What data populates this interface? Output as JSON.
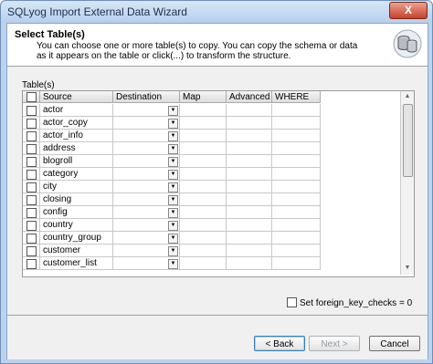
{
  "window": {
    "title": "SQLyog Import External Data Wizard",
    "close_glyph": "X"
  },
  "header": {
    "title": "Select Table(s)",
    "description": "You can choose one or more table(s) to copy. You can copy the schema or data as it appears on the table or click(...) to transform the structure."
  },
  "grid": {
    "label": "Table(s)",
    "columns": [
      "Source",
      "Destination",
      "Map",
      "Advanced",
      "WHERE"
    ],
    "rows": [
      "actor",
      "actor_copy",
      "actor_info",
      "address",
      "blogroll",
      "category",
      "city",
      "closing",
      "config",
      "country",
      "country_group",
      "customer",
      "customer_list"
    ]
  },
  "fk_checks_label": "Set foreign_key_checks = 0",
  "buttons": {
    "back": "< Back",
    "next": "Next >",
    "cancel": "Cancel"
  }
}
